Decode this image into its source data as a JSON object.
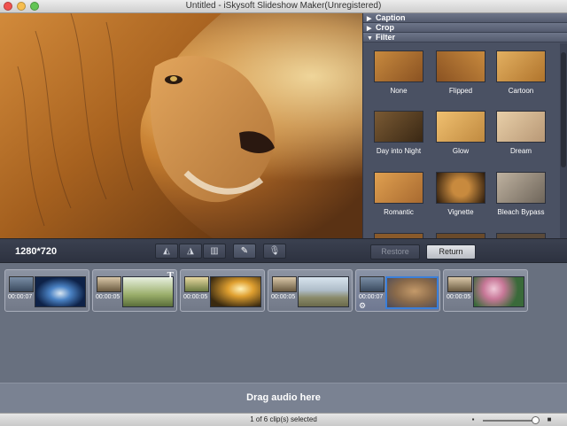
{
  "window": {
    "title": "Untitled - iSkysoft Slideshow Maker(Unregistered)"
  },
  "panel": {
    "sections": [
      {
        "label": "Caption",
        "expanded": false
      },
      {
        "label": "Crop",
        "expanded": false
      },
      {
        "label": "Filter",
        "expanded": true
      }
    ],
    "filters": [
      "None",
      "Flipped",
      "Cartoon",
      "Day into Night",
      "Glow",
      "Dream",
      "Romantic",
      "Vignette",
      "Bleach Bypass"
    ]
  },
  "toolbar": {
    "resolution": "1280*720",
    "restore_label": "Restore",
    "return_label": "Return",
    "icons": [
      "flip-left-icon",
      "flip-right-icon",
      "trash-icon",
      "pencil-icon",
      "microphone-icon"
    ]
  },
  "timeline": {
    "clips": [
      {
        "duration": "00:00:07",
        "selected": false,
        "has_text": false,
        "has_settings": false,
        "scene": "earth"
      },
      {
        "duration": "00:00:05",
        "selected": false,
        "has_text": true,
        "has_settings": false,
        "scene": "grass"
      },
      {
        "duration": "00:00:05",
        "selected": false,
        "has_text": false,
        "has_settings": false,
        "scene": "sunset"
      },
      {
        "duration": "00:00:05",
        "selected": false,
        "has_text": false,
        "has_settings": false,
        "scene": "elephant"
      },
      {
        "duration": "00:00:07",
        "selected": true,
        "has_text": false,
        "has_settings": true,
        "scene": "lion"
      },
      {
        "duration": "00:00:05",
        "selected": false,
        "has_text": false,
        "has_settings": false,
        "scene": "flowers"
      }
    ],
    "audio_label": "Drag audio here"
  },
  "status": {
    "text": "1 of 6 clip(s) selected",
    "zoom_level": 0.9
  },
  "colors": {
    "accent": "#3b7fd9",
    "panel_bg": "#4a5163",
    "timeline_bg": "#68707f"
  }
}
